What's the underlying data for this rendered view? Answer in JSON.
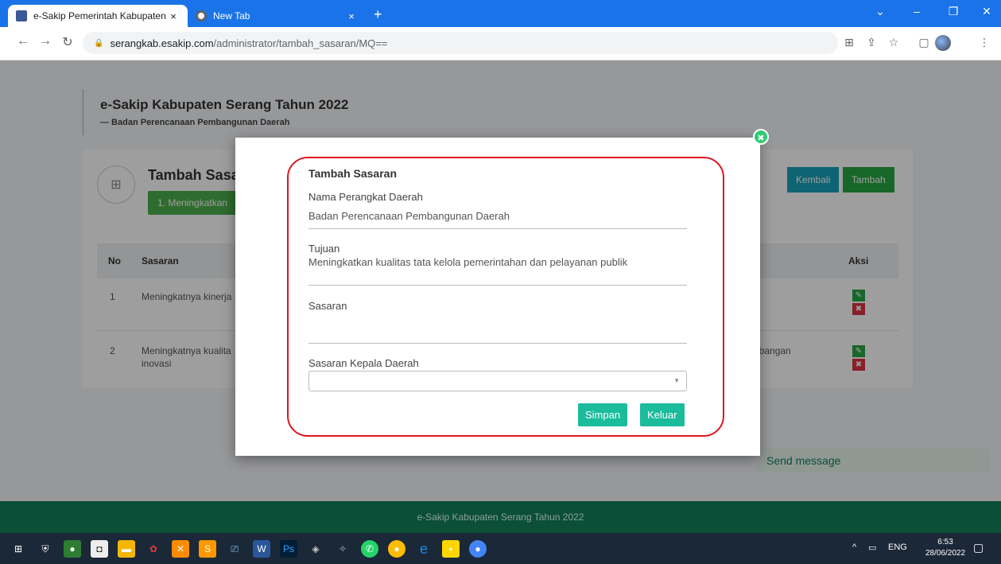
{
  "browser": {
    "tabs": [
      {
        "title": "e-Sakip Pemerintah Kabupaten S",
        "close": "×"
      },
      {
        "title": "New Tab",
        "close": "×"
      }
    ],
    "new_tab": "+",
    "url_host": "serangkab.esakip.com",
    "url_path": "/administrator/tambah_sasaran/MQ=="
  },
  "page": {
    "title": "e-Sakip Kabupaten Serang Tahun 2022",
    "subtitle": "— Badan Perencanaan Pembangunan Daerah",
    "card_title": "Tambah Sasa",
    "badge": "1. Meningkatkan",
    "kembali": "Kembali",
    "tambah": "Tambah",
    "table": {
      "headers": {
        "no": "No",
        "sasaran": "Sasaran",
        "aksi": "Aksi"
      },
      "rows": [
        {
          "no": "1",
          "sasaran": "Meningkatnya kinerja",
          "extra": ""
        },
        {
          "no": "2",
          "sasaran": "Meningkatnya kualita",
          "sasaran_2": "inovasi",
          "extra": "nbangan"
        }
      ]
    },
    "footer": "e-Sakip Kabupaten Serang Tahun 2022",
    "send_message": "Send message"
  },
  "modal": {
    "title": "Tambah Sasaran",
    "perangkat_label": "Nama Perangkat Daerah",
    "perangkat_value": "Badan Perencanaan Pembangunan Daerah",
    "tujuan_label": "Tujuan",
    "tujuan_value": "Meningkatkan kualitas tata kelola pemerintahan dan pelayanan publik",
    "sasaran_label": "Sasaran",
    "sasaran_value": "",
    "kepala_label": "Sasaran Kepala Daerah",
    "kepala_value": "",
    "simpan": "Simpan",
    "keluar": "Keluar"
  },
  "taskbar": {
    "lang": "ENG",
    "time": "6:53",
    "date": "28/06/2022"
  }
}
